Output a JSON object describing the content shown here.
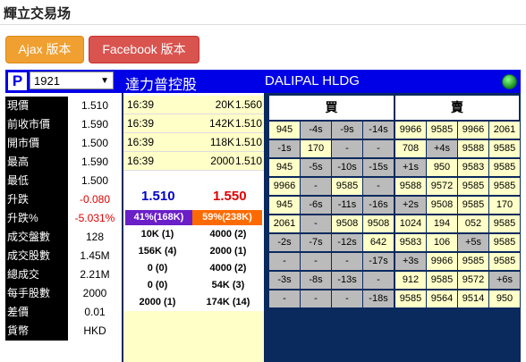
{
  "page": {
    "title": "輝立交易场"
  },
  "buttons": {
    "ajax": "Ajax 版本",
    "facebook": "Facebook 版本"
  },
  "stock": {
    "logo": "P",
    "code": "1921",
    "name_chi": "達力普控股",
    "name_eng": "DALIPAL HLDG"
  },
  "quote": [
    {
      "label": "現價",
      "value": "1.510"
    },
    {
      "label": "前收市價",
      "value": "1.590"
    },
    {
      "label": "開市價",
      "value": "1.500"
    },
    {
      "label": "最高",
      "value": "1.590"
    },
    {
      "label": "最低",
      "value": "1.500"
    },
    {
      "label": "升跌",
      "value": "-0.080",
      "color": "#e00000"
    },
    {
      "label": "升跌%",
      "value": "-5.031%",
      "color": "#e00000"
    },
    {
      "label": "成交盤數",
      "value": "128"
    },
    {
      "label": "成交股數",
      "value": "1.45M"
    },
    {
      "label": "總成交",
      "value": "2.21M"
    },
    {
      "label": "每手股數",
      "value": "2000"
    },
    {
      "label": "差價",
      "value": "0.01"
    },
    {
      "label": "貨幣",
      "value": "HKD"
    }
  ],
  "trades": [
    {
      "time": "16:39",
      "price": "-",
      "volume": "20K",
      "trade_price": "1.560"
    },
    {
      "time": "16:39",
      "price": "-",
      "volume": "142K",
      "trade_price": "1.510"
    },
    {
      "time": "16:39",
      "price": "-",
      "volume": "118K",
      "trade_price": "1.510"
    },
    {
      "time": "16:39",
      "price": "-",
      "volume": "2000",
      "trade_price": "1.510"
    }
  ],
  "bid_ask": {
    "bid": "1.510",
    "ask": "1.550",
    "bid_pct": "41%(168K)",
    "ask_pct": "59%(238K)"
  },
  "queue": [
    {
      "bid": "10K (1)",
      "ask": "4000 (2)"
    },
    {
      "bid": "156K (4)",
      "ask": "2000 (1)"
    },
    {
      "bid": "0 (0)",
      "ask": "4000 (2)"
    },
    {
      "bid": "0 (0)",
      "ask": "54K (3)"
    },
    {
      "bid": "2000 (1)",
      "ask": "174K (14)"
    }
  ],
  "broker_headers": {
    "buy": "買",
    "sell": "賣"
  },
  "broker_rows": [
    [
      "945",
      "-4s",
      "-9s",
      "-14s",
      "9966",
      "9585",
      "9966",
      "2061"
    ],
    [
      "-1s",
      "170",
      "-",
      "-",
      "708",
      "+4s",
      "9588",
      "9585"
    ],
    [
      "945",
      "-5s",
      "-10s",
      "-15s",
      "+1s",
      "950",
      "9583",
      "9585"
    ],
    [
      "9966",
      "-",
      "9585",
      "-",
      "9588",
      "9572",
      "9585",
      "9585"
    ],
    [
      "945",
      "-6s",
      "-11s",
      "-16s",
      "+2s",
      "9508",
      "9585",
      "170"
    ],
    [
      "2061",
      "-",
      "9508",
      "9508",
      "1024",
      "194",
      "052",
      "9585"
    ],
    [
      "-2s",
      "-7s",
      "-12s",
      "642",
      "9583",
      "106",
      "+5s",
      "9585"
    ],
    [
      "-",
      "-",
      "-",
      "-17s",
      "+3s",
      "9966",
      "9585",
      "9585"
    ],
    [
      "-3s",
      "-8s",
      "-13s",
      "-",
      "912",
      "9585",
      "9572",
      "+6s"
    ],
    [
      "-",
      "-",
      "-",
      "-18s",
      "9585",
      "9564",
      "9514",
      "950"
    ]
  ]
}
